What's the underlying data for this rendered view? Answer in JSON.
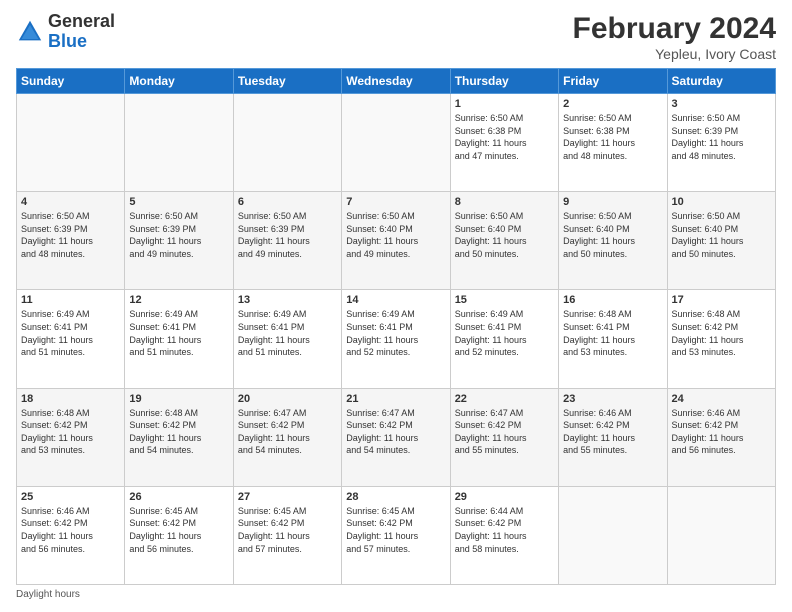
{
  "logo": {
    "general": "General",
    "blue": "Blue"
  },
  "header": {
    "month": "February 2024",
    "location": "Yepleu, Ivory Coast"
  },
  "days_of_week": [
    "Sunday",
    "Monday",
    "Tuesday",
    "Wednesday",
    "Thursday",
    "Friday",
    "Saturday"
  ],
  "weeks": [
    [
      {
        "day": "",
        "info": ""
      },
      {
        "day": "",
        "info": ""
      },
      {
        "day": "",
        "info": ""
      },
      {
        "day": "",
        "info": ""
      },
      {
        "day": "1",
        "info": "Sunrise: 6:50 AM\nSunset: 6:38 PM\nDaylight: 11 hours\nand 47 minutes."
      },
      {
        "day": "2",
        "info": "Sunrise: 6:50 AM\nSunset: 6:38 PM\nDaylight: 11 hours\nand 48 minutes."
      },
      {
        "day": "3",
        "info": "Sunrise: 6:50 AM\nSunset: 6:39 PM\nDaylight: 11 hours\nand 48 minutes."
      }
    ],
    [
      {
        "day": "4",
        "info": "Sunrise: 6:50 AM\nSunset: 6:39 PM\nDaylight: 11 hours\nand 48 minutes."
      },
      {
        "day": "5",
        "info": "Sunrise: 6:50 AM\nSunset: 6:39 PM\nDaylight: 11 hours\nand 49 minutes."
      },
      {
        "day": "6",
        "info": "Sunrise: 6:50 AM\nSunset: 6:39 PM\nDaylight: 11 hours\nand 49 minutes."
      },
      {
        "day": "7",
        "info": "Sunrise: 6:50 AM\nSunset: 6:40 PM\nDaylight: 11 hours\nand 49 minutes."
      },
      {
        "day": "8",
        "info": "Sunrise: 6:50 AM\nSunset: 6:40 PM\nDaylight: 11 hours\nand 50 minutes."
      },
      {
        "day": "9",
        "info": "Sunrise: 6:50 AM\nSunset: 6:40 PM\nDaylight: 11 hours\nand 50 minutes."
      },
      {
        "day": "10",
        "info": "Sunrise: 6:50 AM\nSunset: 6:40 PM\nDaylight: 11 hours\nand 50 minutes."
      }
    ],
    [
      {
        "day": "11",
        "info": "Sunrise: 6:49 AM\nSunset: 6:41 PM\nDaylight: 11 hours\nand 51 minutes."
      },
      {
        "day": "12",
        "info": "Sunrise: 6:49 AM\nSunset: 6:41 PM\nDaylight: 11 hours\nand 51 minutes."
      },
      {
        "day": "13",
        "info": "Sunrise: 6:49 AM\nSunset: 6:41 PM\nDaylight: 11 hours\nand 51 minutes."
      },
      {
        "day": "14",
        "info": "Sunrise: 6:49 AM\nSunset: 6:41 PM\nDaylight: 11 hours\nand 52 minutes."
      },
      {
        "day": "15",
        "info": "Sunrise: 6:49 AM\nSunset: 6:41 PM\nDaylight: 11 hours\nand 52 minutes."
      },
      {
        "day": "16",
        "info": "Sunrise: 6:48 AM\nSunset: 6:41 PM\nDaylight: 11 hours\nand 53 minutes."
      },
      {
        "day": "17",
        "info": "Sunrise: 6:48 AM\nSunset: 6:42 PM\nDaylight: 11 hours\nand 53 minutes."
      }
    ],
    [
      {
        "day": "18",
        "info": "Sunrise: 6:48 AM\nSunset: 6:42 PM\nDaylight: 11 hours\nand 53 minutes."
      },
      {
        "day": "19",
        "info": "Sunrise: 6:48 AM\nSunset: 6:42 PM\nDaylight: 11 hours\nand 54 minutes."
      },
      {
        "day": "20",
        "info": "Sunrise: 6:47 AM\nSunset: 6:42 PM\nDaylight: 11 hours\nand 54 minutes."
      },
      {
        "day": "21",
        "info": "Sunrise: 6:47 AM\nSunset: 6:42 PM\nDaylight: 11 hours\nand 54 minutes."
      },
      {
        "day": "22",
        "info": "Sunrise: 6:47 AM\nSunset: 6:42 PM\nDaylight: 11 hours\nand 55 minutes."
      },
      {
        "day": "23",
        "info": "Sunrise: 6:46 AM\nSunset: 6:42 PM\nDaylight: 11 hours\nand 55 minutes."
      },
      {
        "day": "24",
        "info": "Sunrise: 6:46 AM\nSunset: 6:42 PM\nDaylight: 11 hours\nand 56 minutes."
      }
    ],
    [
      {
        "day": "25",
        "info": "Sunrise: 6:46 AM\nSunset: 6:42 PM\nDaylight: 11 hours\nand 56 minutes."
      },
      {
        "day": "26",
        "info": "Sunrise: 6:45 AM\nSunset: 6:42 PM\nDaylight: 11 hours\nand 56 minutes."
      },
      {
        "day": "27",
        "info": "Sunrise: 6:45 AM\nSunset: 6:42 PM\nDaylight: 11 hours\nand 57 minutes."
      },
      {
        "day": "28",
        "info": "Sunrise: 6:45 AM\nSunset: 6:42 PM\nDaylight: 11 hours\nand 57 minutes."
      },
      {
        "day": "29",
        "info": "Sunrise: 6:44 AM\nSunset: 6:42 PM\nDaylight: 11 hours\nand 58 minutes."
      },
      {
        "day": "",
        "info": ""
      },
      {
        "day": "",
        "info": ""
      }
    ]
  ],
  "footer": {
    "daylight_label": "Daylight hours"
  }
}
